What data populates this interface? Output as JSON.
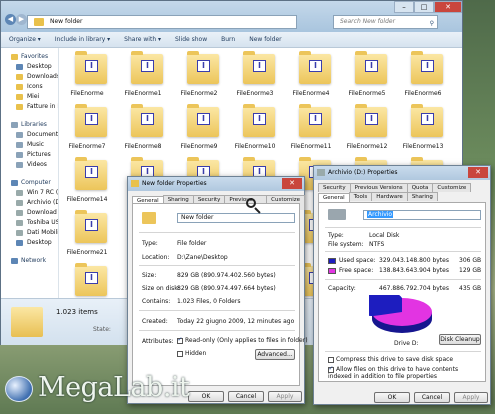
{
  "explorer": {
    "address": "New folder",
    "search_placeholder": "Search New folder",
    "toolbar": [
      "Organize ▾",
      "Include in library ▾",
      "Share with ▾",
      "Slide show",
      "Burn",
      "New folder"
    ],
    "sidebar": [
      {
        "label": "Favorites",
        "header": true,
        "icon": "star-icon",
        "color": "#e9c14c"
      },
      {
        "label": "Desktop",
        "icon": "desktop-icon",
        "color": "#5d86b5"
      },
      {
        "label": "Downloads",
        "icon": "downloads-icon",
        "color": "#e9c14c"
      },
      {
        "label": "Icons",
        "icon": "folder-icon",
        "color": "#e9c14c"
      },
      {
        "label": "Miei",
        "icon": "folder-icon",
        "color": "#e9c14c"
      },
      {
        "label": "Fatture in P",
        "icon": "folder-icon",
        "color": "#e9c14c"
      },
      {
        "gap": true
      },
      {
        "label": "Libraries",
        "header": true,
        "icon": "library-icon",
        "color": "#8aa2b8"
      },
      {
        "label": "Documents",
        "icon": "documents-icon",
        "color": "#8aa2b8"
      },
      {
        "label": "Music",
        "icon": "music-icon",
        "color": "#8aa2b8"
      },
      {
        "label": "Pictures",
        "icon": "pictures-icon",
        "color": "#8aa2b8"
      },
      {
        "label": "Videos",
        "icon": "videos-icon",
        "color": "#8aa2b8"
      },
      {
        "gap": true
      },
      {
        "label": "Computer",
        "header": true,
        "icon": "computer-icon",
        "color": "#5d86b5"
      },
      {
        "label": "Win 7 RC (C",
        "icon": "drive-icon",
        "color": "#9aa"
      },
      {
        "label": "Archivio (D",
        "icon": "drive-icon",
        "color": "#9aa"
      },
      {
        "label": "Download (",
        "icon": "drive-icon",
        "color": "#9aa"
      },
      {
        "label": "Toshiba US",
        "icon": "drive-icon",
        "color": "#9aa"
      },
      {
        "label": "Dati Mobili",
        "icon": "drive-icon",
        "color": "#9aa"
      },
      {
        "label": "Desktop",
        "icon": "desktop-icon",
        "color": "#5d86b5"
      },
      {
        "gap": true
      },
      {
        "label": "Network",
        "header": true,
        "icon": "network-icon",
        "color": "#5d86b5"
      }
    ],
    "files": [
      "FileEnorme",
      "FileEnorme1",
      "FileEnorme2",
      "FileEnorme3",
      "FileEnorme4",
      "FileEnorme5",
      "FileEnorme6",
      "FileEnorme7",
      "FileEnorme8",
      "FileEnorme9",
      "FileEnorme10",
      "FileEnorme11",
      "FileEnorme12",
      "FileEnorme13",
      "FileEnorme14",
      "",
      "",
      "",
      "",
      "",
      "",
      "FileEnorme21",
      "",
      "",
      "",
      "",
      "",
      "",
      "",
      "",
      "",
      "",
      "",
      "",
      ""
    ],
    "status": {
      "count": "1.023 items",
      "state_label": "State:"
    }
  },
  "folder_props": {
    "title": "New folder Properties",
    "tabs": [
      "General",
      "Sharing",
      "Security",
      "Previous Versions",
      "Customize"
    ],
    "name": "New folder",
    "type_label": "Type:",
    "type_value": "File folder",
    "location_label": "Location:",
    "location_value": "D:\\Zane\\Desktop",
    "size_label": "Size:",
    "size_value": "829 GB (890.974.402.560 bytes)",
    "sizeondisk_label": "Size on disk:",
    "sizeondisk_value": "829 GB (890.974.497.664 bytes)",
    "contains_label": "Contains:",
    "contains_value": "1.023 Files, 0 Folders",
    "created_label": "Created:",
    "created_value": "Today 22 giugno 2009, 12 minutes ago",
    "attributes_label": "Attributes:",
    "readonly_label": "Read-only (Only applies to files in folder)",
    "hidden_label": "Hidden",
    "advanced_button": "Advanced...",
    "ok": "OK",
    "cancel": "Cancel",
    "apply": "Apply"
  },
  "disk_props": {
    "title": "Archivio (D:) Properties",
    "tabs_top": [
      "Security",
      "Previous Versions",
      "Quota",
      "Customize"
    ],
    "tabs_bottom": [
      "General",
      "Tools",
      "Hardware",
      "Sharing"
    ],
    "name": "Archivio",
    "type_label": "Type:",
    "type_value": "Local Disk",
    "fs_label": "File system:",
    "fs_value": "NTFS",
    "used_label": "Used space:",
    "used_bytes": "329.043.148.800 bytes",
    "used_gb": "306 GB",
    "free_label": "Free space:",
    "free_bytes": "138.843.643.904 bytes",
    "free_gb": "129 GB",
    "capacity_label": "Capacity:",
    "capacity_bytes": "467.886.792.704 bytes",
    "capacity_gb": "435 GB",
    "drive_label": "Drive D:",
    "cleanup_button": "Disk Cleanup",
    "compress_label": "Compress this drive to save disk space",
    "index_label": "Allow files on this drive to have contents indexed in addition to file properties",
    "used_color": "#1d1dbf",
    "free_color": "#e234e2",
    "used_fraction": 0.7033,
    "ok": "OK",
    "cancel": "Cancel",
    "apply": "Apply"
  },
  "watermark": {
    "text": "MegaLab.it",
    "logo": "MLI"
  }
}
